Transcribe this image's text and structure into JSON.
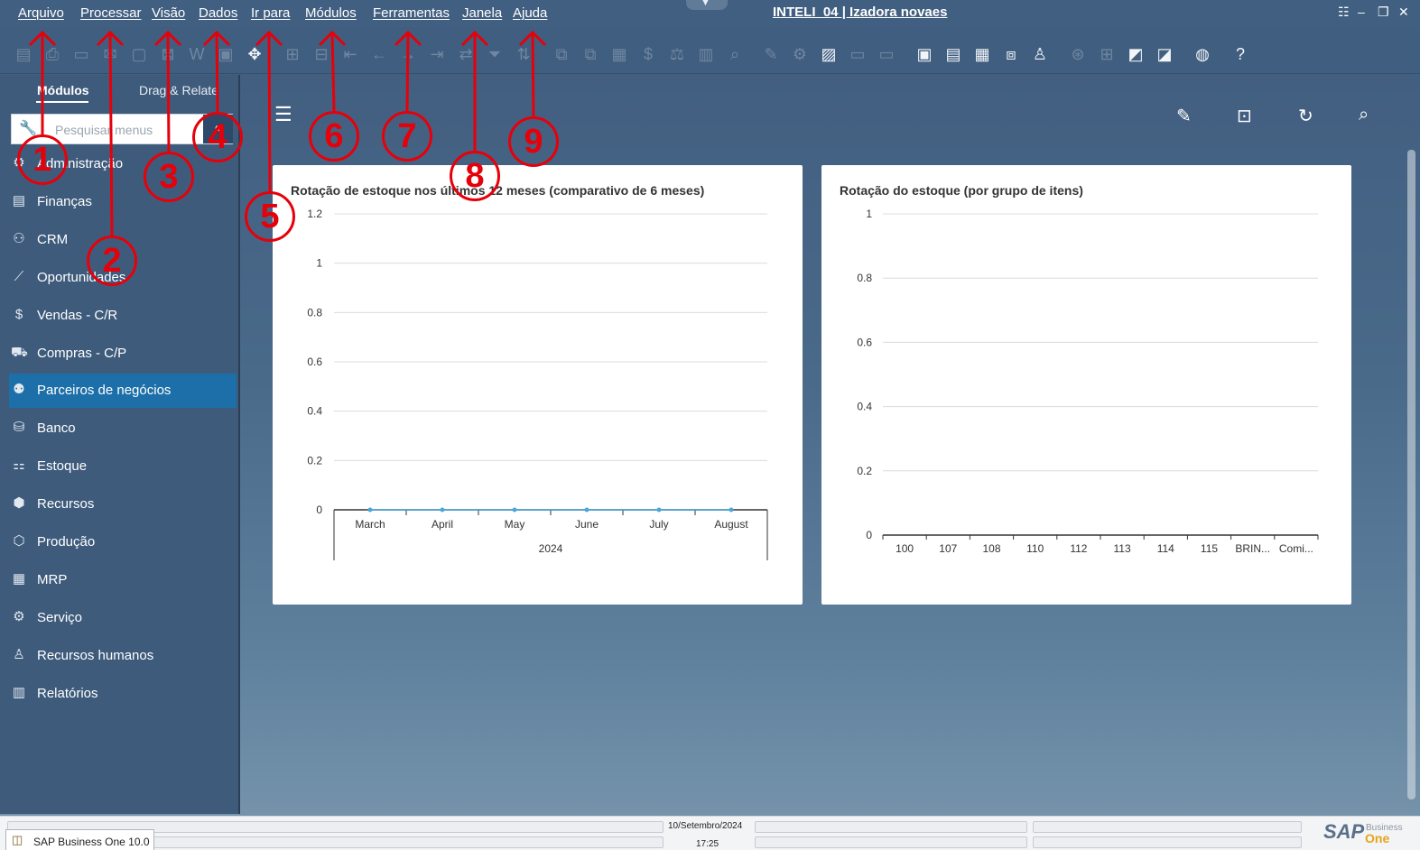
{
  "window": {
    "title": "INTELI_04 | Izadora novaes"
  },
  "menu": [
    "Arquivo",
    "Processar",
    "Visão",
    "Dados",
    "Ir para",
    "Módulos",
    "Ferramentas",
    "Janela",
    "Ajuda"
  ],
  "sidebar": {
    "tabs": [
      "Módulos",
      "Drag & Relate"
    ],
    "search_placeholder": "Pesquisar menus",
    "items": [
      {
        "label": "Administração",
        "icon": "gear-admin-icon"
      },
      {
        "label": "Finanças",
        "icon": "finance-icon"
      },
      {
        "label": "CRM",
        "icon": "crm-icon"
      },
      {
        "label": "Oportunidades",
        "icon": "opportunities-icon"
      },
      {
        "label": "Vendas - C/R",
        "icon": "sales-icon"
      },
      {
        "label": "Compras - C/P",
        "icon": "cart-icon"
      },
      {
        "label": "Parceiros de negócios",
        "icon": "partners-icon"
      },
      {
        "label": "Banco",
        "icon": "bank-icon"
      },
      {
        "label": "Estoque",
        "icon": "inventory-icon"
      },
      {
        "label": "Recursos",
        "icon": "resources-icon"
      },
      {
        "label": "Produção",
        "icon": "production-icon"
      },
      {
        "label": "MRP",
        "icon": "mrp-icon"
      },
      {
        "label": "Serviço",
        "icon": "service-icon"
      },
      {
        "label": "Recursos humanos",
        "icon": "person-icon"
      },
      {
        "label": "Relatórios",
        "icon": "reports-icon"
      }
    ],
    "selected": "Parceiros de negócios"
  },
  "annotations": [
    "1",
    "2",
    "3",
    "4",
    "5",
    "6",
    "7",
    "8",
    "9"
  ],
  "status": {
    "date": "10/Setembro/2024",
    "time": "17:25",
    "app": "SAP Business One 10.0"
  },
  "logo": {
    "brand": "SAP",
    "sub1": "Business",
    "sub2": "One"
  },
  "chart_data": [
    {
      "type": "line",
      "title": "Rotação de estoque nos últimos 12 meses (comparativo de 6 meses)",
      "categories": [
        "March",
        "April",
        "May",
        "June",
        "July",
        "August"
      ],
      "group_label": "2024",
      "series": [
        {
          "values": [
            0,
            0,
            0,
            0,
            0,
            0
          ]
        }
      ],
      "yticks": [
        "1.2",
        "1",
        "0.8",
        "0.6",
        "0.4",
        "0.2",
        "0"
      ],
      "ylim": [
        0,
        1.2
      ],
      "grid": true
    },
    {
      "type": "bar",
      "title": "Rotação do estoque (por grupo de itens)",
      "categories": [
        "100",
        "107",
        "108",
        "110",
        "112",
        "113",
        "114",
        "115",
        "BRIN...",
        "Comi..."
      ],
      "values": [
        0,
        0,
        0,
        0,
        0,
        0,
        0,
        0,
        0,
        0
      ],
      "yticks": [
        "1",
        "0.8",
        "0.6",
        "0.4",
        "0.2",
        "0"
      ],
      "ylim": [
        0,
        1
      ],
      "grid": true
    }
  ]
}
